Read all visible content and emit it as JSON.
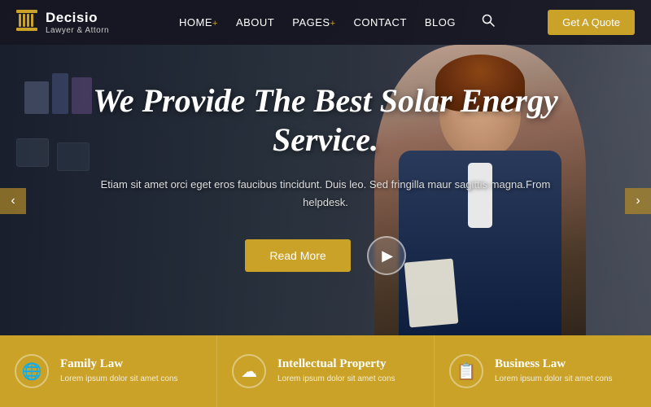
{
  "logo": {
    "title": "Decisio",
    "subtitle": "Lawyer & Attorn",
    "icon": "⚖"
  },
  "nav": {
    "links": [
      {
        "label": "HOME",
        "hasPlus": true
      },
      {
        "label": "ABOUT",
        "hasPlus": false
      },
      {
        "label": "PAGES",
        "hasPlus": true
      },
      {
        "label": "CONTACT",
        "hasPlus": false
      },
      {
        "label": "BLOG",
        "hasPlus": false
      }
    ],
    "cta_label": "Get A Quote"
  },
  "hero": {
    "title": "We Provide The Best Solar Energy Service.",
    "subtitle": "Etiam sit amet orci eget eros faucibus tincidunt. Duis leo. Sed fringilla maur\nsagittis magna.From helpdesk.",
    "readmore_label": "Read More"
  },
  "nav_arrows": {
    "left": "‹",
    "right": "›"
  },
  "services": [
    {
      "icon": "🌐",
      "title": "Family Law",
      "desc": "Lorem ipsum dolor sit amet cons"
    },
    {
      "icon": "☁",
      "title": "Intellectual Property",
      "desc": "Lorem ipsum dolor sit amet cons"
    },
    {
      "icon": "📋",
      "title": "Business Law",
      "desc": "Lorem ipsum dolor sit amet cons"
    }
  ]
}
